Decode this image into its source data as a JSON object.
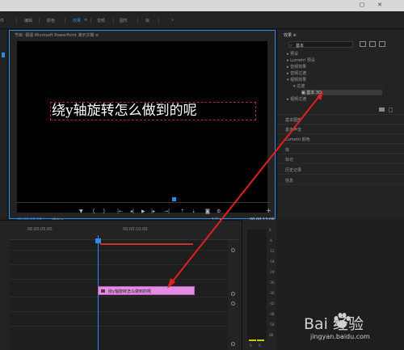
{
  "nav": {
    "items": [
      "件",
      "编辑",
      "颜色",
      "效果",
      "音频",
      "图形",
      "库"
    ],
    "active_index": 3,
    "more": "»"
  },
  "window": {
    "close": "✕",
    "maximize": "▢"
  },
  "monitor": {
    "title": "节目: 假逼 Microsoft PowerPoint 演示文稿  ≡",
    "video_text": "绕y轴旋转怎么做到的呢",
    "timecode_current": "00:00:08:06",
    "fit": "适合",
    "resolution": "1/2",
    "timecode_duration": "00:00:13:06"
  },
  "transport": {
    "marker": "▼",
    "in_point": "{",
    "out_point": "}",
    "go_in": "|←",
    "step_back": "◂|",
    "play": "▶",
    "step_fwd": "|▸",
    "go_out": "→|",
    "lift": "⇡",
    "extract": "⇣",
    "export_frame": "◙",
    "settings": "⚙",
    "add": "+"
  },
  "effects": {
    "title": "效果  ≡",
    "search_value": "基本",
    "items": [
      {
        "label": "▸  预设",
        "level": 0
      },
      {
        "label": "▸  Lumetri 预设",
        "level": 0
      },
      {
        "label": "▸  音频效果",
        "level": 0
      },
      {
        "label": "▸  音频过渡",
        "level": 0
      },
      {
        "label": "▾  视频效果",
        "level": 0
      },
      {
        "label": "▾  过渡",
        "level": 1
      },
      {
        "label": "基本 3D",
        "level": 2
      },
      {
        "label": "▸  视频过渡",
        "level": 0
      }
    ],
    "sections": [
      "基本图形",
      "基本声音",
      "Lumetri 颜色",
      "库",
      "标记",
      "历史记录",
      "信息"
    ]
  },
  "timeline": {
    "ruler_labels": [
      "00:00:05:00",
      "00:00:10:00"
    ],
    "clip_label": "绕y轴旋转怎么做到的呢"
  },
  "meters": {
    "labels": [
      "0",
      "-6",
      "-12",
      "-18",
      "-24",
      "-30",
      "-36",
      "-42",
      "-48",
      "-54",
      "dB"
    ],
    "bottom": [
      "S",
      "S"
    ]
  },
  "watermark": {
    "brand": "Bai 经验",
    "url": "jingyan.baidu.com"
  },
  "colors": {
    "accent": "#2d8ceb",
    "clip": "#e48be4",
    "annotation": "#e02020"
  }
}
